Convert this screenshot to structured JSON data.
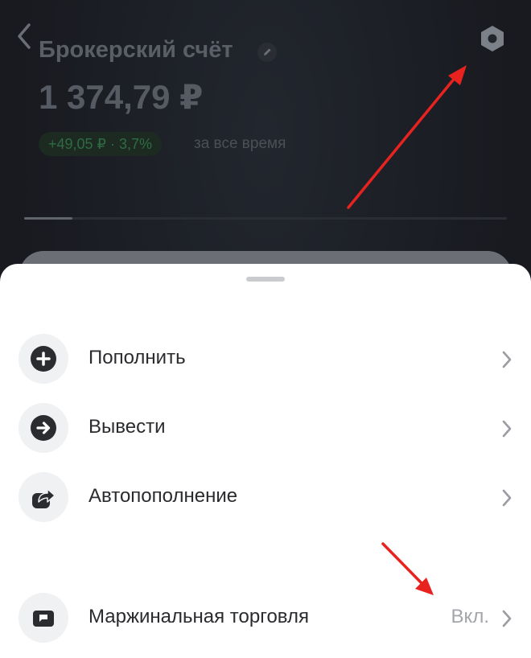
{
  "header": {
    "account_title": "Брокерский счёт",
    "balance": "1 374,79 ₽",
    "profit": "+49,05 ₽ · 3,7%",
    "period": "за все время",
    "progress_fraction": 0.1
  },
  "actions": [
    {
      "label": "Пополнить",
      "icon": "plus-circle-icon"
    },
    {
      "label": "Вывести",
      "icon": "arrow-right-circle-icon"
    },
    {
      "label": "Автопополнение",
      "icon": "auto-replenish-icon"
    }
  ],
  "margin_trading": {
    "label": "Маржинальная торговля",
    "status": "Вкл.",
    "icon": "margin-wallet-icon"
  },
  "colors": {
    "accent_arrow": "#e8231f",
    "profit_green": "#2f6b43",
    "sheet_background": "#ffffff",
    "dark_background": "#1a1c22"
  }
}
